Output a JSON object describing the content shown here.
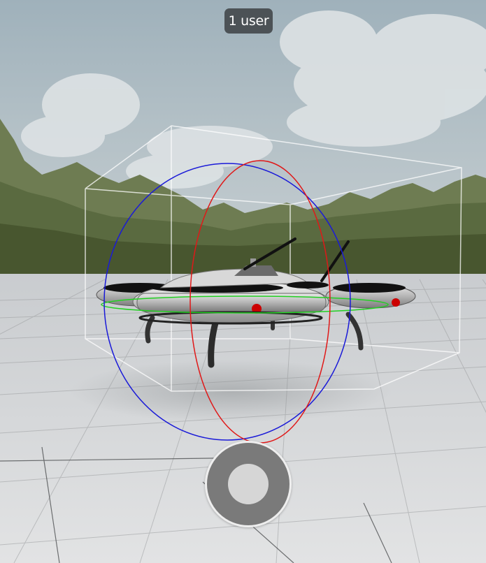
{
  "viewer": {
    "user_count_label": "1 user",
    "controls": {
      "ar_button_icon": "ar-ring-icon"
    },
    "gizmo": {
      "x_ring_color": "#e01818",
      "y_ring_color": "#1a1ad8",
      "z_ring_color": "#22d022",
      "bounding_box_color": "#ffffff"
    },
    "model": {
      "body_color": "#c9c9c9",
      "light_color": "#cc0000"
    },
    "environment": {
      "sky_color": "#a9b8c0",
      "floor_color": "#dcdddf"
    }
  }
}
